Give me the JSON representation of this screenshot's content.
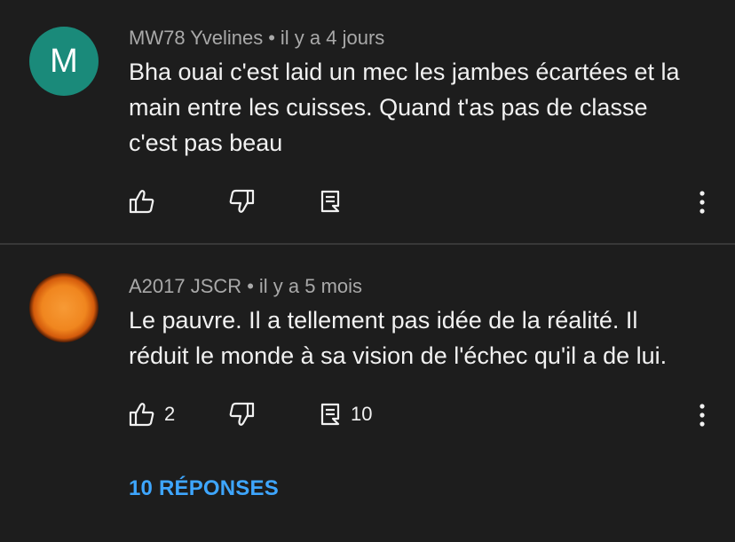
{
  "comments": [
    {
      "avatar_letter": "M",
      "author": "MW78 Yvelines",
      "separator": "•",
      "time": "il y a 4 jours",
      "lines": [
        "Bha ouai c'est laid un mec les jambes écartées et la",
        "main entre les cuisses. Quand t'as pas de classe",
        "c'est pas beau"
      ],
      "like_icon": "thumbs-up-icon",
      "dislike_icon": "thumbs-down-icon",
      "reply_icon": "reply-comment-icon",
      "more_icon": "more-vert-icon"
    },
    {
      "author": "A2017 JSCR",
      "separator": "•",
      "time": "il y a 5 mois",
      "lines": [
        "Le pauvre. Il a tellement pas idée de la réalité. Il",
        "réduit le monde à sa vision de l'échec qu'il a de lui."
      ],
      "likes": "2",
      "replies_count": "10",
      "like_icon": "thumbs-up-icon",
      "dislike_icon": "thumbs-down-icon",
      "reply_icon": "reply-comment-icon",
      "more_icon": "more-vert-icon",
      "view_replies_label": "10 RÉPONSES"
    }
  ],
  "colors": {
    "background": "#1d1d1d",
    "text_primary": "#f1f1f1",
    "text_secondary": "#a9a9a9",
    "link": "#3ea6ff",
    "avatar_teal": "#1a8a7a"
  }
}
